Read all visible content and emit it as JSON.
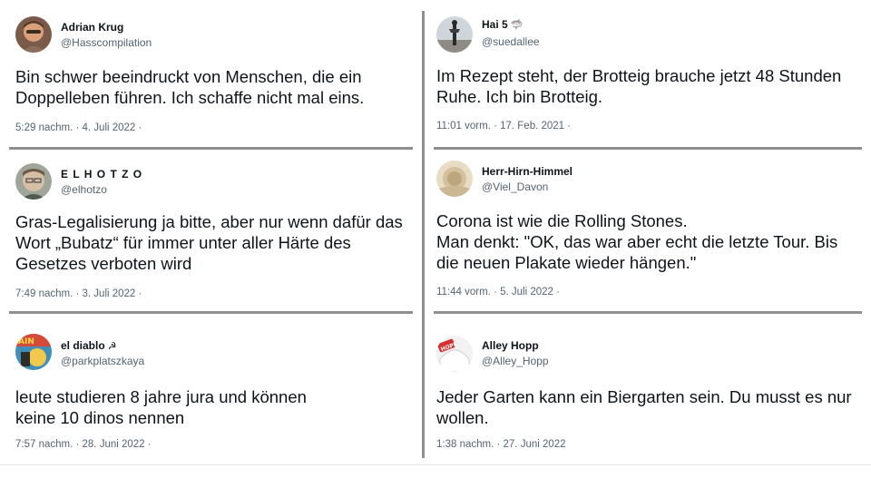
{
  "tweets": [
    {
      "name": "Adrian Krug",
      "handle": "@Hasscompilation",
      "text": [
        "Bin schwer beeindruckt von Menschen, die ein",
        "Doppelleben führen. Ich schaffe nicht mal eins."
      ],
      "meta": "5:29 nachm. · 4. Juli 2022 ·"
    },
    {
      "name": "Hai 5",
      "name_emoji": "🦈",
      "handle": "@suedallee",
      "text": [
        "Im Rezept steht, der Brotteig brauche jetzt 48 Stunden",
        "Ruhe. Ich bin Brotteig."
      ],
      "meta": "11:01 vorm. · 17. Feb. 2021 ·"
    },
    {
      "name": "E L H O T Z O",
      "handle": "@elhotzo",
      "text": [
        "Gras-Legalisierung ja bitte, aber nur wenn dafür das",
        "Wort „Bubatz“ für immer unter aller Härte des",
        "Gesetzes verboten wird"
      ],
      "meta": "7:49 nachm. · 3. Juli 2022 ·"
    },
    {
      "name": "Herr-Hirn-Himmel",
      "handle": "@Viel_Davon",
      "text": [
        "Corona ist wie die Rolling Stones.",
        "Man denkt: \"OK, das war aber echt die letzte Tour. Bis",
        "die neuen Plakate wieder hängen.\""
      ],
      "meta": "11:44 vorm. · 5. Juli 2022 ·"
    },
    {
      "name": "el diablo",
      "name_emoji": "☭",
      "handle": "@parkplatszkaya",
      "text": [
        "leute studieren 8 jahre jura und können",
        "keine 10 dinos nennen"
      ],
      "meta": "7:57 nachm. · 28. Juni 2022 ·"
    },
    {
      "name": "Alley Hopp",
      "handle": "@Alley_Hopp",
      "text": [
        "Jeder Garten kann ein Biergarten sein. Du musst es nur",
        "wollen."
      ],
      "meta": "1:38 nachm. · 27. Juni 2022"
    }
  ],
  "avatars": {
    "adrian": "avatar-icon",
    "hai5": "avatar-icon",
    "elhotzo": "avatar-icon",
    "herr": "avatar-icon",
    "diablo": "avatar-icon",
    "alley": "avatar-icon"
  }
}
